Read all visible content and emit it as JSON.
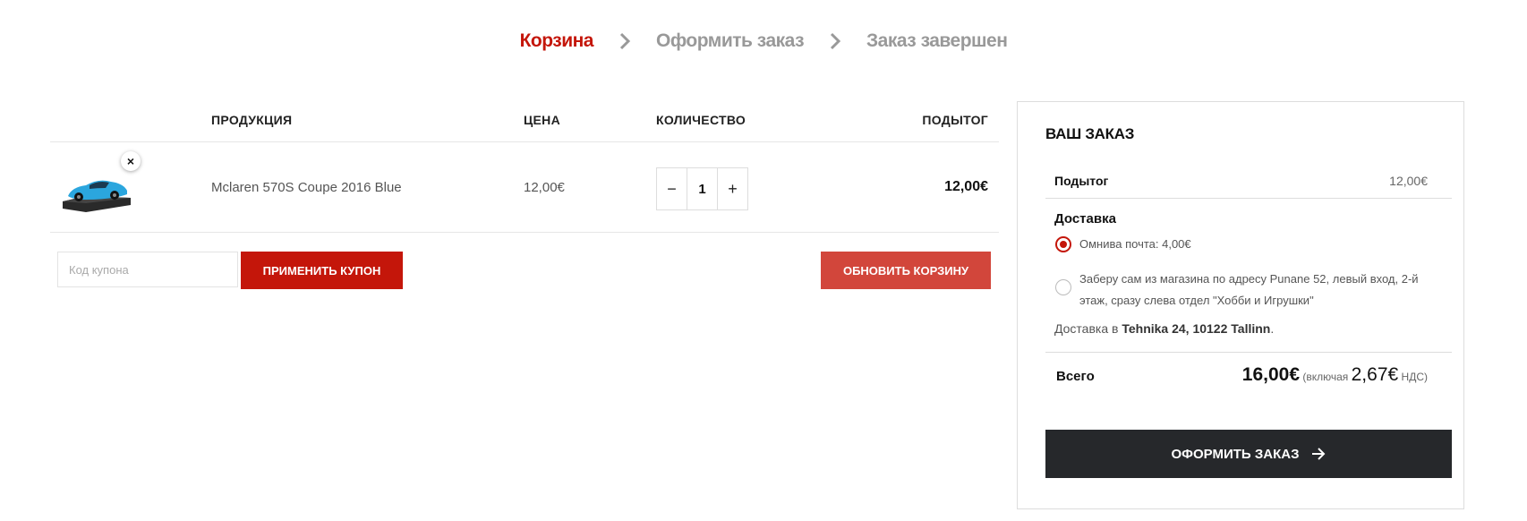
{
  "steps": [
    "Корзина",
    "Оформить заказ",
    "Заказ завершен"
  ],
  "table": {
    "headers": {
      "product": "ПРОДУКЦИЯ",
      "price": "ЦЕНА",
      "quantity": "КОЛИЧЕСТВО",
      "subtotal": "ПОДЫТОГ"
    },
    "rows": [
      {
        "remove_icon": "close-icon",
        "name": "Mclaren 570S Coupe 2016 Blue",
        "price": "12,00€",
        "quantity": "1",
        "minus": "−",
        "plus": "+",
        "subtotal": "12,00€"
      }
    ]
  },
  "actions": {
    "coupon_placeholder": "Код купона",
    "apply_coupon": "ПРИМЕНИТЬ КУПОН",
    "update_cart": "ОБНОВИТЬ КОРЗИНУ"
  },
  "order": {
    "title": "ВАШ ЗАКАЗ",
    "subtotal_label": "Подытог",
    "subtotal_value": "12,00€",
    "delivery_label": "Доставка",
    "options": [
      {
        "label": "Омнива почта: 4,00€",
        "selected": true
      },
      {
        "label": "Заберу сам из магазина по адресу Punane 52, левый вход, 2-й этаж, сразу слева отдел \"Хобби и Игрушки\"",
        "selected": false
      }
    ],
    "delivery_to_prefix": "Доставка в",
    "delivery_to_address": "Tehnika 24, 10122 Tallinn",
    "delivery_to_suffix": ".",
    "total_label": "Всего",
    "total_value": "16,00€",
    "tax_prefix": "(включая",
    "tax_value": "2,67€",
    "tax_suffix": "НДС)",
    "checkout_label": "ОФОРМИТЬ ЗАКАЗ"
  },
  "colors": {
    "accent": "#c4160a",
    "update_button": "#d2463b",
    "checkout_button": "#26282b"
  }
}
